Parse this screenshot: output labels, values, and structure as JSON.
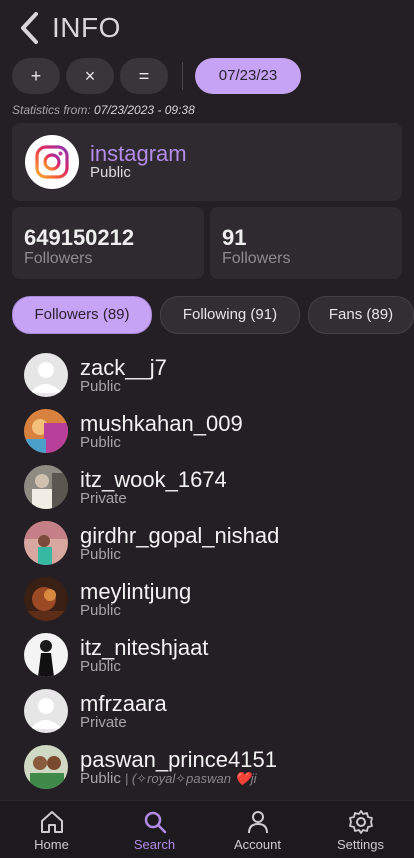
{
  "header": {
    "title": "INFO",
    "back_icon": "chevron-left-icon"
  },
  "toolbar": {
    "plus_label": "+",
    "times_label": "×",
    "equals_label": "=",
    "date_label": "07/23/23"
  },
  "stats_from": {
    "prefix": "Statistics from: ",
    "value": "07/23/2023 - 09:38"
  },
  "app_card": {
    "name": "instagram",
    "visibility": "Public",
    "icon": "instagram-icon",
    "accent": "#b38be8"
  },
  "stats": [
    {
      "number": "649150212",
      "label": "Followers"
    },
    {
      "number": "91",
      "label": "Followers"
    }
  ],
  "tabs": [
    {
      "label": "Followers (89)",
      "active": true
    },
    {
      "label": "Following (91)",
      "active": false
    },
    {
      "label": "Fans (89)",
      "active": false
    }
  ],
  "users": [
    {
      "username": "zack__j7",
      "visibility": "Public",
      "bio": ""
    },
    {
      "username": "mushkahan_009",
      "visibility": "Public",
      "bio": ""
    },
    {
      "username": "itz_wook_1674",
      "visibility": "Private",
      "bio": ""
    },
    {
      "username": "girdhr_gopal_nishad",
      "visibility": "Public",
      "bio": ""
    },
    {
      "username": "meylintjung",
      "visibility": "Public",
      "bio": ""
    },
    {
      "username": "itz_niteshjaat",
      "visibility": "Public",
      "bio": ""
    },
    {
      "username": "mfrzaara",
      "visibility": "Private",
      "bio": ""
    },
    {
      "username": "paswan_prince4151",
      "visibility": "Public",
      "bio": "| (✧royal✧paswan ❤️ji"
    }
  ],
  "navbar": [
    {
      "label": "Home",
      "icon": "home-icon",
      "active": false
    },
    {
      "label": "Search",
      "icon": "search-icon",
      "active": true
    },
    {
      "label": "Account",
      "icon": "account-icon",
      "active": false
    },
    {
      "label": "Settings",
      "icon": "gear-icon",
      "active": false
    }
  ],
  "colors": {
    "accent": "#c7a3f5",
    "background": "#241f24",
    "card": "#2f2a2f"
  }
}
